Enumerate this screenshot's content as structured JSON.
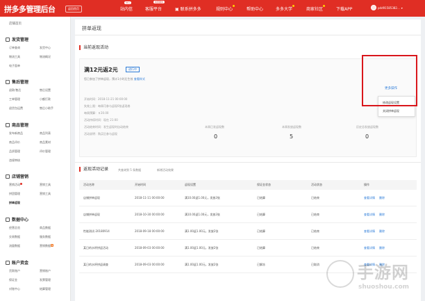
{
  "header": {
    "logo": "拼多多管理后台",
    "back_home": "返回首页",
    "nav": [
      {
        "label": "站内信",
        "badge": "99+"
      },
      {
        "label": "客服平台",
        "badge": "商家服务"
      },
      {
        "label": "联系拼多多",
        "badge": ""
      },
      {
        "label": "规则中心",
        "badge": ""
      },
      {
        "label": "帮助中心",
        "badge": ""
      },
      {
        "label": "多多大学",
        "badge": ""
      },
      {
        "label": "商家社区",
        "badge": ""
      },
      {
        "label": "下载APP",
        "badge": ""
      }
    ],
    "user_name": "pdd91585382..."
  },
  "sidebar": {
    "top_item": "店铺首页",
    "sections": [
      {
        "title": "发货管理",
        "items": [
          "订单查询",
          "发货中心",
          "物流工具",
          "物流概况",
          "电子面单"
        ]
      },
      {
        "title": "售后管理",
        "items": [
          "退款/售后",
          "售后设置",
          "工单管理",
          "小额打款",
          "退货包运费",
          "售后小助手"
        ]
      },
      {
        "title": "商品管理",
        "items": [
          "发布新商品",
          "商品列表",
          "商品评价",
          "商品素材",
          "品质管理",
          "评价管理",
          "违规审核"
        ]
      },
      {
        "title": "店铺营销",
        "items": [
          "营销活动",
          "营销工具",
          "拼团管理",
          "营销工具",
          "拼单返现"
        ]
      },
      {
        "title": "数据中心",
        "items": [
          "经营总览",
          "商品数据",
          "交易数据",
          "服务数据",
          "流量数据",
          "营销数据"
        ]
      },
      {
        "title": "账户资金",
        "items": [
          "货款账户",
          "营销账户",
          "保证金",
          "发票管理",
          "对账中心",
          "结算管理"
        ]
      }
    ]
  },
  "page": {
    "breadcrumb": "拼单返现",
    "current_section": "当前返现活动",
    "records_section": "返现活动记录",
    "records_total_pre": "共查询到",
    "records_total_num": "5",
    "records_total_post": "条数据",
    "new_activity_link": "新增活动效果"
  },
  "promo": {
    "title": "满12元返2元",
    "status": "进行中",
    "desc": "您已参加了拼单返现，预计1小时后生效",
    "desc_link": "查看样式",
    "info": [
      "开始时间：2018-11-21 00:00:00",
      "失效上限：每周可参与返现0张返现卷",
      "每周预算：￥20.00",
      "活动持续时间：现在 21:00",
      "活动结束时间：发生返现时自动结束",
      "活动说明：购买后参与返现"
    ],
    "stats": [
      {
        "label": "本周已发返现数",
        "value": "0"
      },
      {
        "label": "本周发放返现数",
        "value": "5"
      },
      {
        "label": "历史总发放返现数",
        "value": "0"
      }
    ],
    "more_ops": "更多操作",
    "menu": [
      "修改返现设置",
      "关闭拼单返现"
    ]
  },
  "table": {
    "headers": [
      "活动名称",
      "开始时间",
      "返现设置",
      "保证金状态",
      "活动状态",
      "操作"
    ],
    "rows": [
      {
        "name": "店铺拼单返现",
        "start": "2018-11-11 00:00:00",
        "setting": "满10.00返1.00元，发放3张",
        "deposit": "已结算",
        "status": "已结束"
      },
      {
        "name": "店铺拼单返现",
        "start": "2018-10-30 00:00:00",
        "setting": "满10.00返1.00元，发放3张",
        "deposit": "已结算",
        "status": "已结束"
      },
      {
        "name": "性能测试-20180914",
        "start": "2018-09-18 00:00:00",
        "setting": "满1.00返1.00元，发放2张",
        "deposit": "已结算",
        "status": "已结束"
      },
      {
        "name": "某日的水杯拼返活动",
        "start": "2018-09-03 00:00:00",
        "setting": "满1.00返1.00元，发放2张",
        "deposit": "已结算",
        "status": "已结束"
      },
      {
        "name": "某日的水杯拼返调查",
        "start": "2018-09-03 00:00:00",
        "setting": "满1.00返1.00元，发放2张",
        "deposit": "已解冻",
        "status": "已取消"
      }
    ],
    "action_detail": "查看详情",
    "action_delete": "删除"
  },
  "watermark": {
    "text": "手游网",
    "url": "shuoshou.com"
  },
  "colors": {
    "brand": "#e02e24",
    "link": "#2b7bd8",
    "highlight_box": "#d9161b"
  }
}
